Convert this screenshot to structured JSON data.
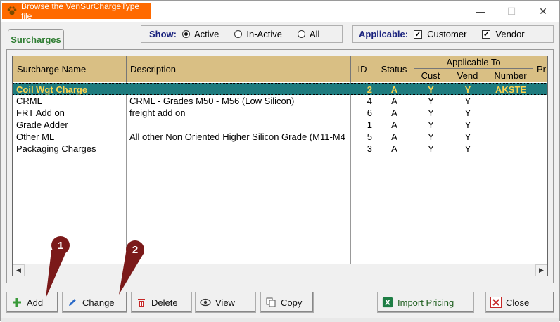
{
  "window": {
    "title": "Browse the VenSurChargeType file",
    "minimize": "—",
    "maximize": "☐",
    "close": "✕"
  },
  "tab": {
    "label": "Surcharges"
  },
  "show": {
    "label": "Show:",
    "options": [
      "Active",
      "In-Active",
      "All"
    ],
    "selected": "Active"
  },
  "applicable": {
    "label": "Applicable:",
    "customer_label": "Customer",
    "customer_checked": true,
    "vendor_label": "Vendor",
    "vendor_checked": true
  },
  "grid": {
    "headers": {
      "name": "Surcharge Name",
      "description": "Description",
      "id": "ID",
      "status": "Status",
      "applicable_to": "Applicable To",
      "cust": "Cust",
      "vend": "Vend",
      "number": "Number",
      "pr": "Pr"
    },
    "rows": [
      {
        "name": "Coil Wgt Charge",
        "description": "",
        "id": "2",
        "status": "A",
        "cust": "Y",
        "vend": "Y",
        "number": "AKSTE",
        "selected": true
      },
      {
        "name": "CRML",
        "description": "CRML - Grades M50 - M56 (Low Silicon)",
        "id": "4",
        "status": "A",
        "cust": "Y",
        "vend": "Y",
        "number": ""
      },
      {
        "name": "FRT Add on",
        "description": "freight add on",
        "id": "6",
        "status": "A",
        "cust": "Y",
        "vend": "Y",
        "number": ""
      },
      {
        "name": "Grade Adder",
        "description": "",
        "id": "1",
        "status": "A",
        "cust": "Y",
        "vend": "Y",
        "number": ""
      },
      {
        "name": "Other ML",
        "description": "All other Non Oriented Higher Silicon Grade (M11-M4",
        "id": "5",
        "status": "A",
        "cust": "Y",
        "vend": "Y",
        "number": ""
      },
      {
        "name": "Packaging Charges",
        "description": "",
        "id": "3",
        "status": "A",
        "cust": "Y",
        "vend": "Y",
        "number": ""
      }
    ]
  },
  "buttons": {
    "add": "Add",
    "change": "Change",
    "delete": "Delete",
    "view": "View",
    "copy": "Copy",
    "import": "Import Pricing",
    "close": "Close"
  },
  "callouts": {
    "one": "1",
    "two": "2"
  },
  "colors": {
    "title_accent": "#ff6a00",
    "header_bg": "#d9bf84",
    "selected_row_bg": "#1e7b7e",
    "selected_row_text": "#ffd54f",
    "callout": "#7b1a1a",
    "tab_text": "#2e7d32"
  }
}
